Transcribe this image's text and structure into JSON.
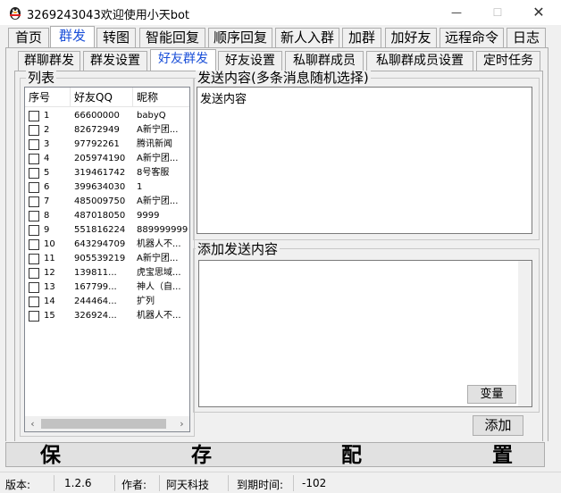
{
  "window": {
    "title": "3269243043欢迎使用小天bot",
    "minimize": "—",
    "maximize": "☐",
    "close": "✕"
  },
  "main_tabs": [
    "首页",
    "群发",
    "转图",
    "智能回复",
    "顺序回复",
    "新人入群",
    "加群",
    "加好友",
    "远程命令",
    "日志"
  ],
  "sub_tabs": [
    "群聊群发",
    "群发设置",
    "好友群发",
    "好友设置",
    "私聊群成员",
    "私聊群成员设置",
    "定时任务"
  ],
  "list_group": {
    "title": "列表",
    "columns": [
      "序号",
      "好友QQ",
      "昵称"
    ],
    "rows": [
      {
        "idx": "1",
        "qq": "66600000",
        "nick": "babyQ"
      },
      {
        "idx": "2",
        "qq": "82672949",
        "nick": "A新宁团..."
      },
      {
        "idx": "3",
        "qq": "97792261",
        "nick": "腾讯新闻"
      },
      {
        "idx": "4",
        "qq": "205974190",
        "nick": "A新宁团..."
      },
      {
        "idx": "5",
        "qq": "319461742",
        "nick": "8号客服"
      },
      {
        "idx": "6",
        "qq": "399634030",
        "nick": "1"
      },
      {
        "idx": "7",
        "qq": "485009750",
        "nick": "A新宁团..."
      },
      {
        "idx": "8",
        "qq": "487018050",
        "nick": "9999"
      },
      {
        "idx": "9",
        "qq": "551816224",
        "nick": "8899999999"
      },
      {
        "idx": "10",
        "qq": "643294709",
        "nick": "机器人不..."
      },
      {
        "idx": "11",
        "qq": "905539219",
        "nick": "A新宁团..."
      },
      {
        "idx": "12",
        "qq": "139811...",
        "nick": "虎宝思域..."
      },
      {
        "idx": "13",
        "qq": "167799...",
        "nick": "神人（自..."
      },
      {
        "idx": "14",
        "qq": "244464...",
        "nick": "扩列"
      },
      {
        "idx": "15",
        "qq": "326924...",
        "nick": "机器人不..."
      }
    ],
    "scroll_left": "‹",
    "scroll_right": "›"
  },
  "send_group": {
    "title": "发送内容(多条消息随机选择)",
    "content": "发送内容"
  },
  "add_group": {
    "title": "添加发送内容",
    "content": "",
    "variable_button": "变量"
  },
  "add_button": "添加",
  "save_button": [
    "保",
    "存",
    "配",
    "置"
  ],
  "statusbar": {
    "version_label": "版本:",
    "version": "1.2.6",
    "author_label": "作者:",
    "author": "阿天科技",
    "expire_label": "到期时间:",
    "expire": "-102"
  },
  "colors": {
    "active_tab_text": "#1a4fd8",
    "window_bg": "#f0f0f0"
  }
}
